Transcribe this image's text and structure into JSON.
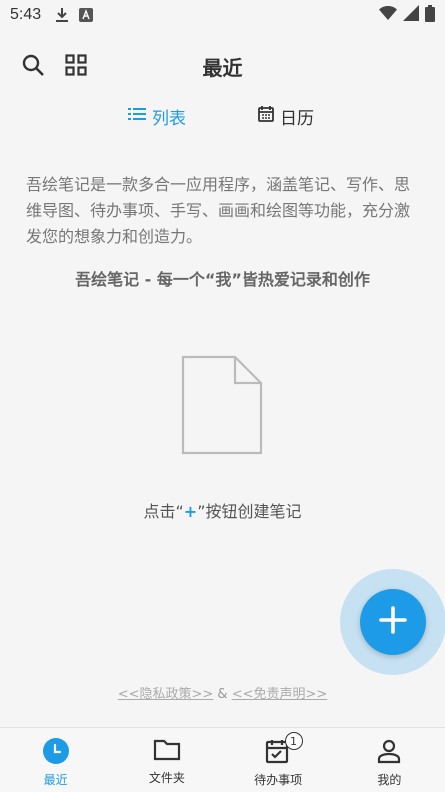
{
  "status_bar": {
    "time": "5:43",
    "icons": [
      "download-icon",
      "a-box-icon",
      "wifi-icon",
      "signal-icon",
      "battery-icon"
    ]
  },
  "header": {
    "title": "最近",
    "left_icons": [
      "search-icon",
      "grid-icon"
    ]
  },
  "view_tabs": [
    {
      "label": "列表",
      "icon": "list-icon",
      "active": true
    },
    {
      "label": "日历",
      "icon": "calendar-icon",
      "active": false
    }
  ],
  "intro": {
    "description": "吾绘笔记是一款多合一应用程序，涵盖笔记、写作、思维导图、待办事项、手写、画画和绘图等功能，充分激发您的想象力和创造力。",
    "slogan": "吾绘笔记 - 每一个“我”皆热爱记录和创作"
  },
  "empty_state": {
    "hint_prefix": "点击“",
    "hint_plus": "+",
    "hint_suffix": "”按钮创建笔记"
  },
  "fab": {
    "icon": "plus-icon"
  },
  "legal": {
    "privacy": "<<隐私政策>>",
    "separator": "&",
    "disclaimer": "<<免责声明>>"
  },
  "bottom_nav": {
    "items": [
      {
        "label": "最近",
        "icon": "clock-icon",
        "active": true
      },
      {
        "label": "文件夹",
        "icon": "folder-icon",
        "active": false
      },
      {
        "label": "待办事项",
        "icon": "calendar-check-icon",
        "active": false,
        "badge": "1"
      },
      {
        "label": "我的",
        "icon": "person-icon",
        "active": false
      }
    ]
  },
  "colors": {
    "accent": "#1e9be6",
    "background": "#f5f5f5",
    "text": "#333333"
  }
}
